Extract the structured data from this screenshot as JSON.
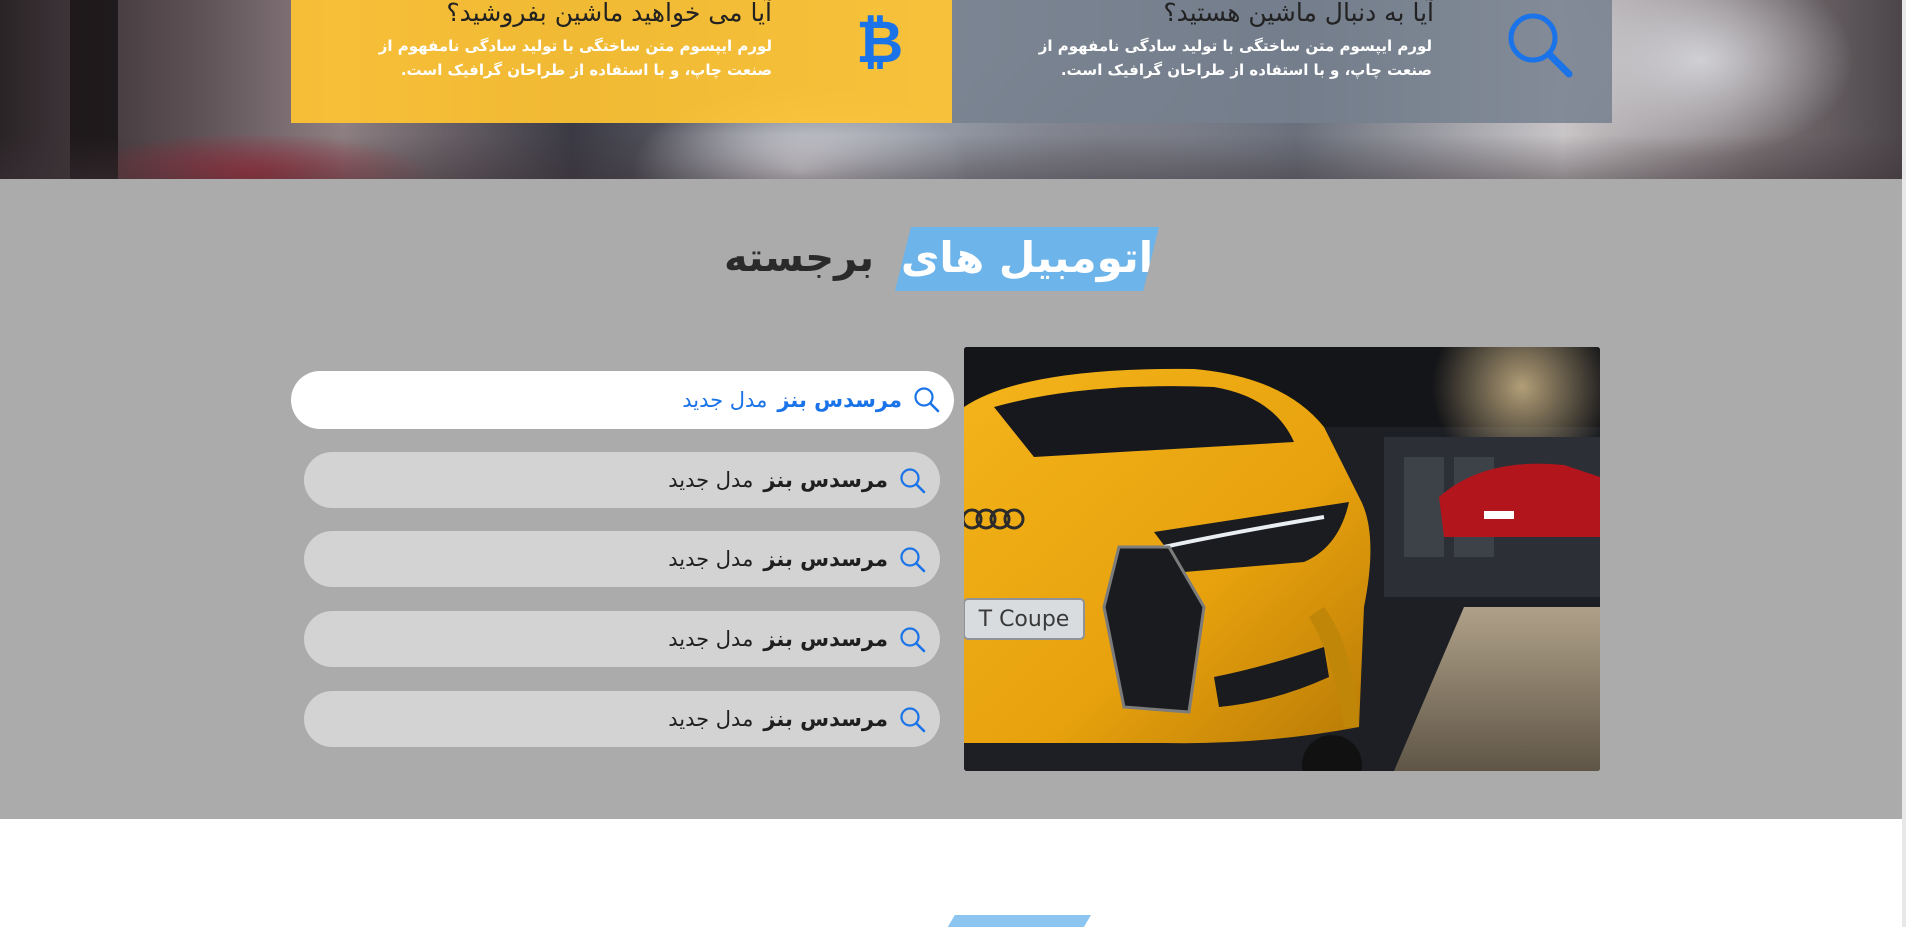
{
  "hero": {
    "find_card": {
      "title": "آیا به دنبال ماشین هستید؟",
      "description": "لورم ایپسوم متن ساختگی با تولید سادگی نامفهوم از صنعت چاپ، و با استفاده از طراحان گرافیک است.",
      "icon": "search-icon"
    },
    "sell_card": {
      "title": "آیا می خواهید ماشین بفروشید؟",
      "description": "لورم ایپسوم متن ساختگی با تولید سادگی نامفهوم از صنعت چاپ، و با استفاده از طراحان گرافیک است.",
      "icon": "bitcoin-icon",
      "icon_glyph": "₿"
    }
  },
  "featured": {
    "heading_highlight": "اتومبیل های",
    "heading_rest": "برجسته",
    "image": {
      "plate_text": "T Coupe"
    },
    "results": [
      {
        "brand": "مرسدس بنز",
        "model": "مدل جدید",
        "active": true
      },
      {
        "brand": "مرسدس بنز",
        "model": "مدل جدید",
        "active": false
      },
      {
        "brand": "مرسدس بنز",
        "model": "مدل جدید",
        "active": false
      },
      {
        "brand": "مرسدس بنز",
        "model": "مدل جدید",
        "active": false
      },
      {
        "brand": "مرسدس بنز",
        "model": "مدل جدید",
        "active": false
      }
    ]
  },
  "colors": {
    "accent_blue": "#1a73e8",
    "heading_blue": "#6cb4ea",
    "sell_yellow": "#ffc433",
    "section_gray": "#ababab",
    "result_gray": "#d3d3d3"
  }
}
